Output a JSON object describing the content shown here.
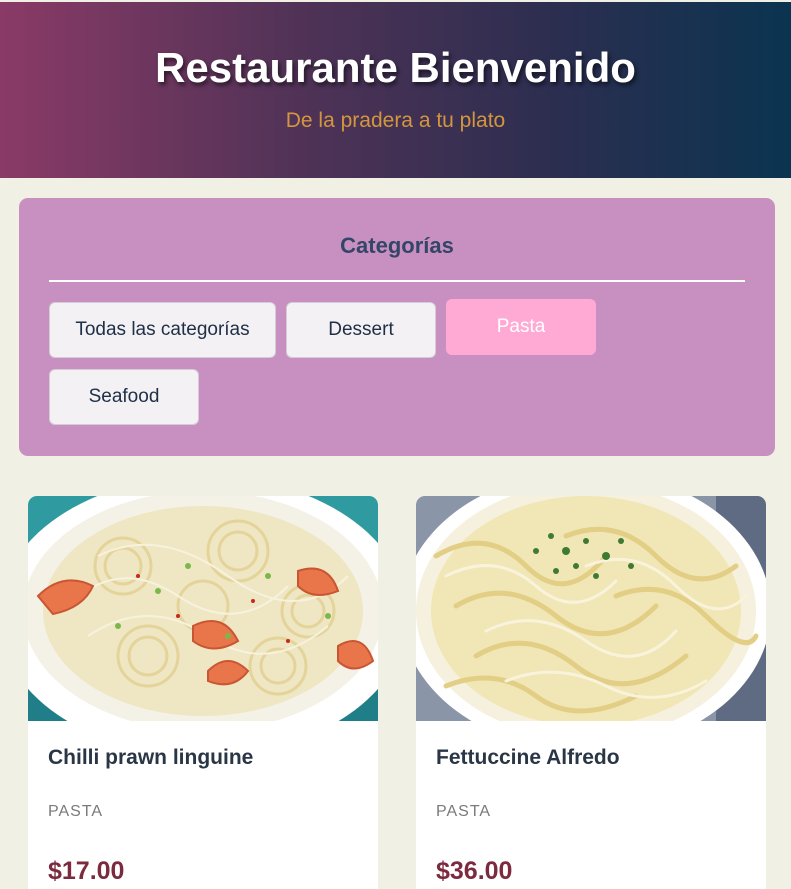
{
  "header": {
    "title": "Restaurante Bienvenido",
    "subtitle": "De la pradera a tu plato"
  },
  "categories": {
    "heading": "Categorías",
    "buttons": [
      {
        "label": "Todas las categorías",
        "active": false
      },
      {
        "label": "Dessert",
        "active": false
      },
      {
        "label": "Pasta",
        "active": true
      },
      {
        "label": "Seafood",
        "active": false
      }
    ]
  },
  "menu": {
    "items": [
      {
        "name": "Chilli prawn linguine",
        "category": "PASTA",
        "price": "$17.00",
        "image": "shrimp-linguine-photo"
      },
      {
        "name": "Fettuccine Alfredo",
        "category": "PASTA",
        "price": "$36.00",
        "image": "fettuccine-alfredo-photo"
      }
    ]
  },
  "colors": {
    "header_gradient_start": "#8a3a66",
    "header_gradient_end": "#0a3450",
    "subtitle": "#d3963e",
    "categories_panel": "#c890c1",
    "active_button": "#ffaad5",
    "price": "#7c2a3e",
    "page_background": "#f1f0e4"
  }
}
